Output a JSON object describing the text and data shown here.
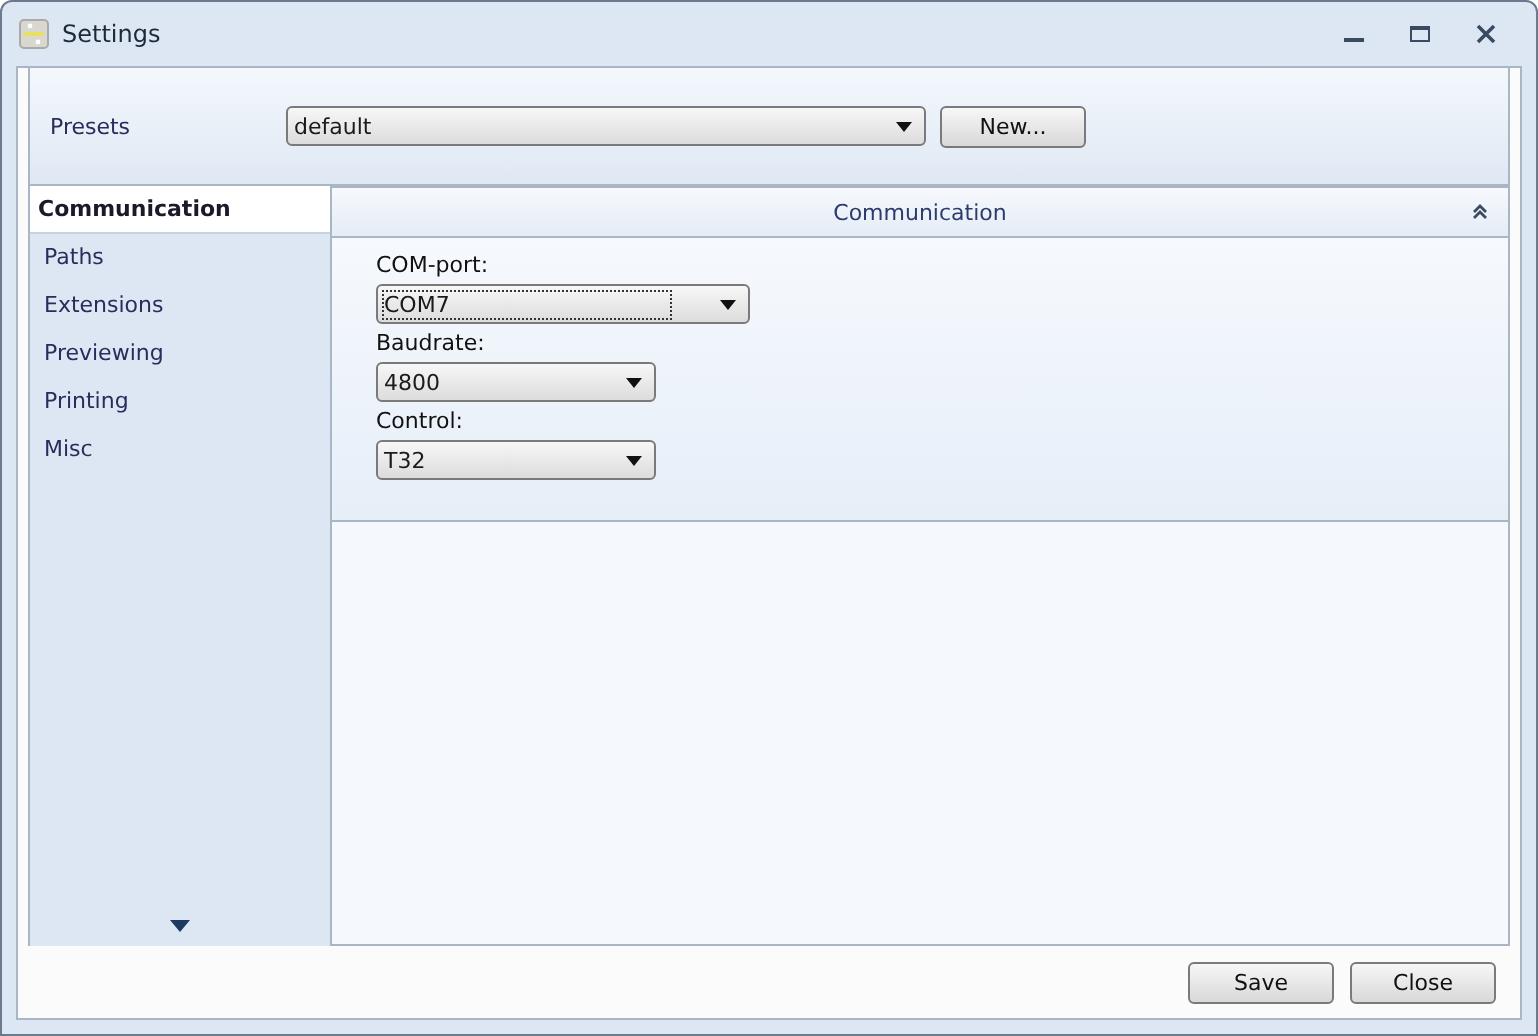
{
  "window": {
    "title": "Settings"
  },
  "presets": {
    "label": "Presets",
    "value": "default",
    "new_button": "New..."
  },
  "sidebar": {
    "items": [
      {
        "label": "Communication",
        "selected": true
      },
      {
        "label": "Paths",
        "selected": false
      },
      {
        "label": "Extensions",
        "selected": false
      },
      {
        "label": "Previewing",
        "selected": false
      },
      {
        "label": "Printing",
        "selected": false
      },
      {
        "label": "Misc",
        "selected": false
      }
    ]
  },
  "section": {
    "title": "Communication",
    "expanded": true,
    "fields": [
      {
        "label": "COM-port:",
        "value": "COM7",
        "focused": true,
        "wide": true
      },
      {
        "label": "Baudrate:",
        "value": "4800",
        "focused": false,
        "wide": false
      },
      {
        "label": "Control:",
        "value": "T32",
        "focused": false,
        "wide": false
      }
    ]
  },
  "buttons": [
    "Save",
    "Close"
  ]
}
